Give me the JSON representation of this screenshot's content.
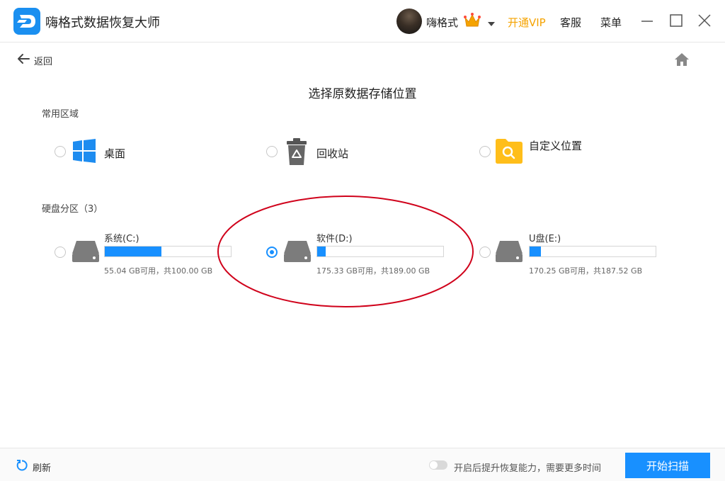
{
  "app": {
    "title": "嗨格式数据恢复大师",
    "username": "嗨格式",
    "vip_label": "开通VIP",
    "service_label": "客服",
    "menu_label": "菜单"
  },
  "nav": {
    "back_label": "返回"
  },
  "page": {
    "title": "选择原数据存储位置"
  },
  "common": {
    "section_label": "常用区域",
    "items": [
      {
        "label": "桌面",
        "icon": "windows-icon",
        "selected": false
      },
      {
        "label": "回收站",
        "icon": "recycle-bin-icon",
        "selected": false
      },
      {
        "label": "自定义位置",
        "icon": "folder-search-icon",
        "selected": false
      }
    ]
  },
  "disks": {
    "section_label": "硬盘分区（3）",
    "items": [
      {
        "name": "系统(C:)",
        "info": "55.04 GB可用，共100.00 GB",
        "used_fraction": 0.45,
        "selected": false
      },
      {
        "name": "软件(D:)",
        "info": "175.33 GB可用，共189.00 GB",
        "used_fraction": 0.07,
        "selected": true
      },
      {
        "name": "U盘(E:)",
        "info": "170.25 GB可用，共187.52 GB",
        "used_fraction": 0.09,
        "selected": false
      }
    ]
  },
  "footer": {
    "refresh_label": "刷新",
    "toggle_label": "开启后提升恢复能力，需要更多时间",
    "toggle_on": false,
    "start_label": "开始扫描"
  },
  "colors": {
    "accent": "#1890ff",
    "vip": "#f5a300",
    "annotation": "#d0021b"
  }
}
